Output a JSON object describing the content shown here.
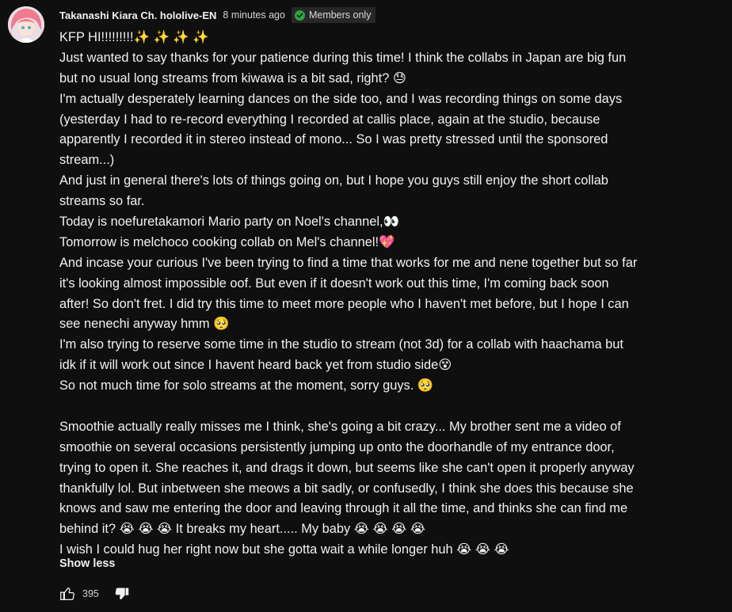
{
  "comment": {
    "author": "Takanashi Kiara Ch. hololive-EN",
    "timestamp": "8 minutes ago",
    "badge": "Members only",
    "lines": [
      "KFP HI!!!!!!!!!✨ ✨ ✨ ✨",
      "Just wanted to say thanks for your patience during this time! I think the collabs in Japan are big fun",
      "but no usual long streams from kiwawa is a bit sad, right? 😓",
      "I'm actually desperately learning dances on the side too, and I was recording things on some days",
      "(yesterday I had to re-record everything I recorded at callis place, again at the studio, because",
      "apparently I recorded it in stereo instead of mono... So I was pretty stressed until the sponsored",
      "stream...)",
      "And just in general there's lots of things going on, but I hope you guys still enjoy the short collab",
      "streams so far.",
      "Today is noefuretakamori Mario party on Noel's channel,👀",
      "Tomorrow is melchoco cooking collab on Mel's channel!💖",
      "And incase your curious I've been trying to find a time that works for me and nene together but so far",
      "it's looking almost impossible oof. But even if it doesn't work out this time, I'm coming back soon",
      "after! So don't fret. I did try this time to meet more people who I haven't met before, but I hope I can",
      "see nenechi anyway hmm 🥺",
      "I'm also trying to reserve some time in the studio to stream (not 3d) for a collab with haachama but",
      "idk if it will work out since I havent heard back yet from studio side😵",
      "So not much time for solo streams at the moment, sorry guys. 🥺",
      "",
      "Smoothie actually really misses me I think, she's going a bit crazy... My brother sent me a video of",
      "smoothie on several occasions persistently jumping up onto the doorhandle of my entrance door,",
      "trying to open it. She reaches it, and drags it down, but seems like she can't open it properly anyway",
      "thankfully lol. But inbetween she meows a bit sadly, or confusedly, I think she does this because she",
      "knows and saw me entering the door and leaving through it all the time, and thinks she can find me",
      "behind it? 😭 😭 😭  It breaks my heart..... My baby 😭 😭 😭 😭",
      "I wish I could hug her right now but she gotta wait a while longer huh 😭 😭 😭"
    ],
    "show_less": "Show less",
    "like_count": "395"
  },
  "icons": {
    "badge": "checkmark-icon",
    "like": "thumbs-up-icon",
    "dislike": "thumbs-down-icon"
  },
  "colors": {
    "background": "#0f0f0f",
    "text": "#f1f1f1",
    "badge_bg": "#272727",
    "badge_check": "#2ba640"
  }
}
